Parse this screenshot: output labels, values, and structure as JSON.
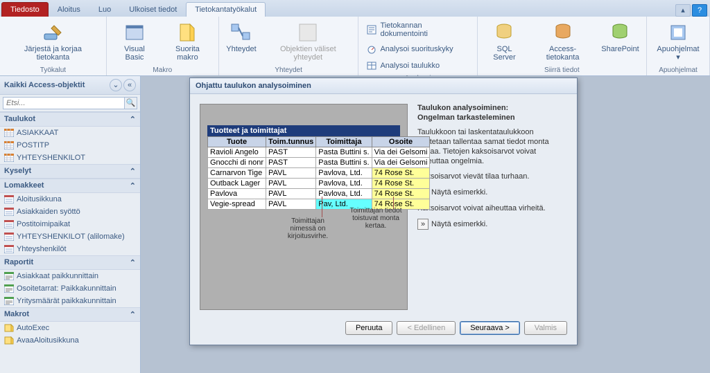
{
  "tabs": {
    "file": "Tiedosto",
    "home": "Aloitus",
    "create": "Luo",
    "external": "Ulkoiset tiedot",
    "dbtools": "Tietokantatyökalut"
  },
  "ribbon": {
    "groups": {
      "tools": "Työkalut",
      "macro": "Makro",
      "relations": "Yhteydet",
      "analyze": "Analysoi",
      "movedata": "Siirrä tiedot",
      "addins": "Apuohjelmat"
    },
    "btns": {
      "compact": "Järjestä ja korjaa tietokanta",
      "vb": "Visual Basic",
      "runmacro": "Suorita makro",
      "relations": "Yhteydet",
      "objdeps": "Objektien väliset yhteydet",
      "dbdoc": "Tietokannan dokumentointi",
      "perf": "Analysoi suorituskyky",
      "table": "Analysoi taulukko",
      "sql": "SQL Server",
      "access": "Access-tietokanta",
      "sp": "SharePoint",
      "addins": "Apuohjelmat"
    }
  },
  "nav": {
    "title": "Kaikki Access-objektit",
    "search_ph": "Etsi...",
    "cats": {
      "tables": "Taulukot",
      "queries": "Kyselyt",
      "forms": "Lomakkeet",
      "reports": "Raportit",
      "macros": "Makrot"
    },
    "tables": [
      "ASIAKKAAT",
      "POSTITP",
      "YHTEYSHENKILOT"
    ],
    "forms": [
      "Aloitusikkuna",
      "Asiakkaiden syöttö",
      "Postitoimipaikat",
      "YHTEYSHENKILOT (alilomake)",
      "Yhteyshenkilöt"
    ],
    "reports": [
      "Asiakkaat paikkunnittain",
      "Osoitetarrat: Paikkakunnittain",
      "Yritysmäärät paikkakunnittain"
    ],
    "macros": [
      "AutoExec",
      "AvaaAloitusikkuna"
    ]
  },
  "wizard": {
    "title": "Ohjattu taulukon analysoiminen",
    "heading1": "Taulukon analysoiminen:",
    "heading2": "Ongelman tarkasteleminen",
    "para1": "Taulukkoon tai laskentataulukkoon saatetaan tallentaa samat tiedot monta kertaa. Tietojen kaksoisarvot voivat aiheuttaa ongelmia.",
    "para2": "Kaksoisarvot vievät tilaa turhaan.",
    "para3": "Kaksoisarvot voivat aiheuttaa virheitä.",
    "example": "Näytä esimerkki.",
    "ann1": "Toimittajan nimessä on kirjoitusvirhe.",
    "ann2": "Toimittajan tiedot toistuvat monta kertaa.",
    "embed_title": "Tuotteet ja toimittajat",
    "cols": {
      "c1": "Tuote",
      "c2": "Toim.tunnus",
      "c3": "Toimittaja",
      "c4": "Osoite"
    },
    "rows": [
      {
        "c1": "Ravioli Angelo",
        "c2": "PAST",
        "c3": "Pasta Buttini s.",
        "c4": "Via dei Gelsomi"
      },
      {
        "c1": "Gnocchi di nonr",
        "c2": "PAST",
        "c3": "Pasta Buttini s.",
        "c4": "Via dei Gelsomi"
      },
      {
        "c1": "Carnarvon Tige",
        "c2": "PAVL",
        "c3": "Pavlova, Ltd.",
        "c4": "74 Rose St.",
        "hl4": true
      },
      {
        "c1": "Outback Lager",
        "c2": "PAVL",
        "c3": "Pavlova, Ltd.",
        "c4": "74 Rose St.",
        "hl4": true
      },
      {
        "c1": "Pavlova",
        "c2": "PAVL",
        "c3": "Pavlova, Ltd.",
        "c4": "74 Rose St.",
        "hl4": true
      },
      {
        "c1": "Vegie-spread",
        "c2": "PAVL",
        "c3": "Pav, Ltd.",
        "c4": "74 Rose St.",
        "hl3": true,
        "hl4": true
      }
    ],
    "buttons": {
      "cancel": "Peruuta",
      "back": "< Edellinen",
      "next": "Seuraava >",
      "finish": "Valmis"
    }
  }
}
